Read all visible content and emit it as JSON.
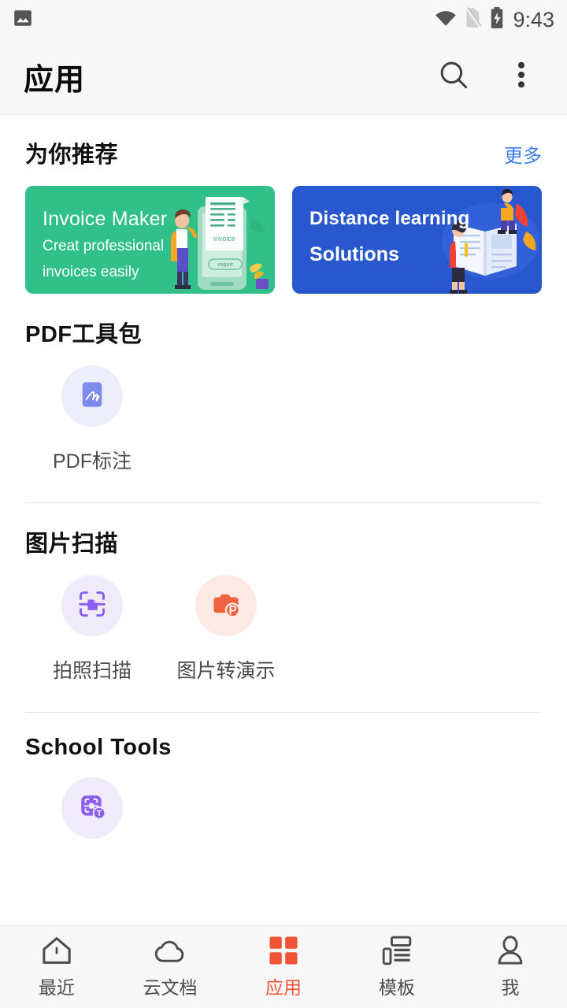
{
  "status_bar": {
    "left_icon": "image-icon",
    "wifi_icon": "wifi-icon",
    "sim_icon": "sim-off-icon",
    "battery_icon": "battery-charging-icon",
    "time": "9:43"
  },
  "app_bar": {
    "title": "应用",
    "search_icon": "search-icon",
    "overflow_icon": "more-vertical-icon"
  },
  "recommend": {
    "title": "为你推荐",
    "more_label": "更多",
    "banners": [
      {
        "title": "Invoice Maker",
        "subtitle_line1": "Creat professional",
        "subtitle_line2": "invoices easily",
        "color": "#31c08a",
        "art": "invoice-illustration"
      },
      {
        "title": "Distance learning",
        "subtitle_line1": "Solutions",
        "color": "#2857ce",
        "art": "distance-learning-illustration"
      }
    ]
  },
  "sections": [
    {
      "title": "PDF工具包",
      "items": [
        {
          "label": "PDF标注",
          "icon": "pdf-annotate-icon",
          "tile": "lavender",
          "color": "#7d8bef"
        }
      ]
    },
    {
      "title": "图片扫描",
      "items": [
        {
          "label": "拍照扫描",
          "icon": "camera-scan-icon",
          "tile": "lav2",
          "color": "#8b5cf0"
        },
        {
          "label": "图片转演示",
          "icon": "photo-to-slides-icon",
          "tile": "peach",
          "color": "#f06240"
        }
      ]
    },
    {
      "title": "School Tools",
      "items": [
        {
          "label": "",
          "icon": "scan-to-text-icon",
          "tile": "lav2",
          "color": "#8b5cf0"
        }
      ]
    }
  ],
  "bottom_nav": {
    "active_color": "#ef5434",
    "items": [
      {
        "label": "最近",
        "icon": "home-icon",
        "active": false
      },
      {
        "label": "云文档",
        "icon": "cloud-icon",
        "active": false
      },
      {
        "label": "应用",
        "icon": "grid-icon",
        "active": true
      },
      {
        "label": "模板",
        "icon": "template-icon",
        "active": false
      },
      {
        "label": "我",
        "icon": "person-icon",
        "active": false
      }
    ]
  }
}
